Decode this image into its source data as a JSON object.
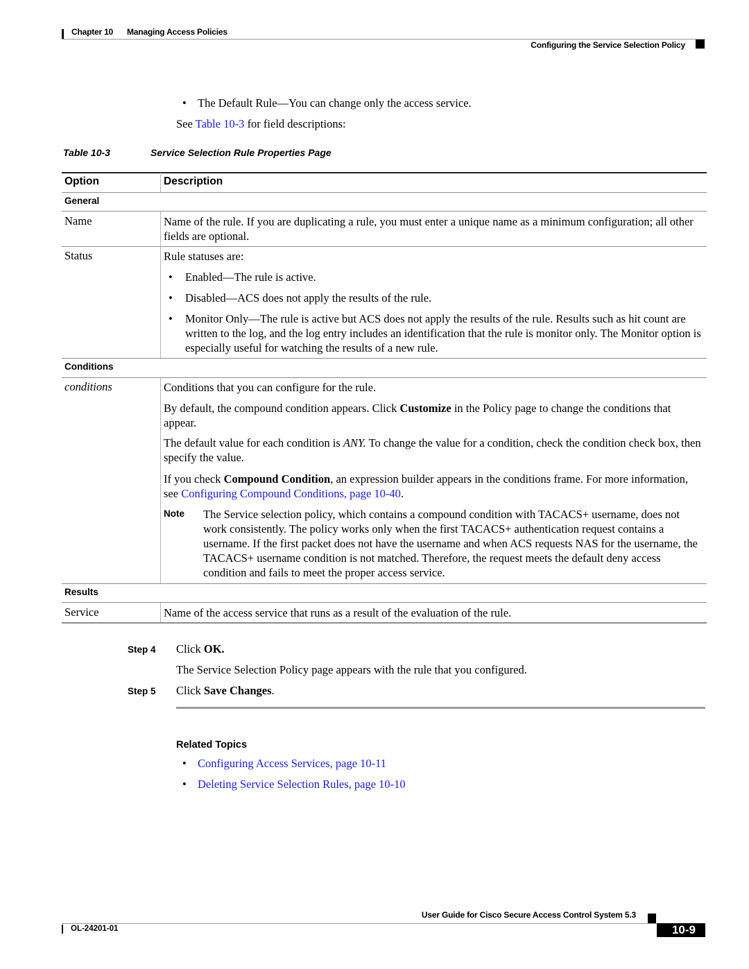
{
  "header": {
    "chapter_label": "Chapter 10",
    "chapter_title": "Managing Access Policies",
    "section_title": "Configuring the Service Selection Policy"
  },
  "intro": {
    "bullet": "The Default Rule—You can change only the access service.",
    "see_prefix": "See ",
    "see_link": "Table 10-3",
    "see_suffix": " for field descriptions:"
  },
  "table": {
    "caption_number": "Table 10-3",
    "caption_title": "Service Selection Rule Properties Page",
    "headers": {
      "option": "Option",
      "description": "Description"
    },
    "sections": {
      "general": "General",
      "conditions": "Conditions",
      "results": "Results"
    },
    "rows": {
      "name": {
        "option": "Name",
        "description": "Name of the rule. If you are duplicating a rule, you must enter a unique name as a minimum configuration; all other fields are optional."
      },
      "status": {
        "option": "Status",
        "intro": "Rule statuses are:",
        "bullets": [
          "Enabled—The rule is active.",
          "Disabled—ACS does not apply the results of the rule.",
          "Monitor Only—The rule is active but ACS does not apply the results of the rule. Results such as hit count are written to the log, and the log entry includes an identification that the rule is monitor only. The Monitor option is especially useful for watching the results of a new rule."
        ]
      },
      "conditions": {
        "option": "conditions",
        "p1": "Conditions that you can configure for the rule.",
        "p2_a": "By default, the compound condition appears. Click ",
        "p2_bold": "Customize",
        "p2_b": " in the Policy page to change the conditions that appear.",
        "p3_a": "The default value for each condition is ",
        "p3_italic": "ANY.",
        "p3_b": " To change the value for a condition, check the condition check box, then specify the value.",
        "p4_a": "If you check ",
        "p4_bold": "Compound Condition",
        "p4_b": ", an expression builder appears in the conditions frame. For more information, see ",
        "p4_link": "Configuring Compound Conditions, page 10-40",
        "p4_c": ".",
        "note_label": "Note",
        "note_text": "The Service selection policy, which contains a compound condition with TACACS+ username, does not work consistently. The policy works only when the first TACACS+ authentication request contains a username. If the first packet does not have the username and when ACS requests NAS for the username, the TACACS+ username condition is not matched. Therefore, the request meets the default deny access condition and fails to meet the proper access service."
      },
      "service": {
        "option": "Service",
        "description": "Name of the access service that runs as a result of the evaluation of the rule."
      }
    }
  },
  "steps": [
    {
      "label": "Step 4",
      "text_a": "Click ",
      "text_bold": "OK.",
      "text_b": "",
      "followup": "The Service Selection Policy page appears with the rule that you configured."
    },
    {
      "label": "Step 5",
      "text_a": "Click ",
      "text_bold": "Save Changes",
      "text_b": "."
    }
  ],
  "related": {
    "heading": "Related Topics",
    "links": [
      "Configuring Access Services, page 10-11",
      "Deleting Service Selection Rules, page 10-10"
    ]
  },
  "footer": {
    "guide_title": "User Guide for Cisco Secure Access Control System 5.3",
    "doc_number": "OL-24201-01",
    "page_number": "10-9"
  },
  "colors": {
    "link": "#1a1adb",
    "rule": "#8c8c8c",
    "text": "#000000"
  }
}
